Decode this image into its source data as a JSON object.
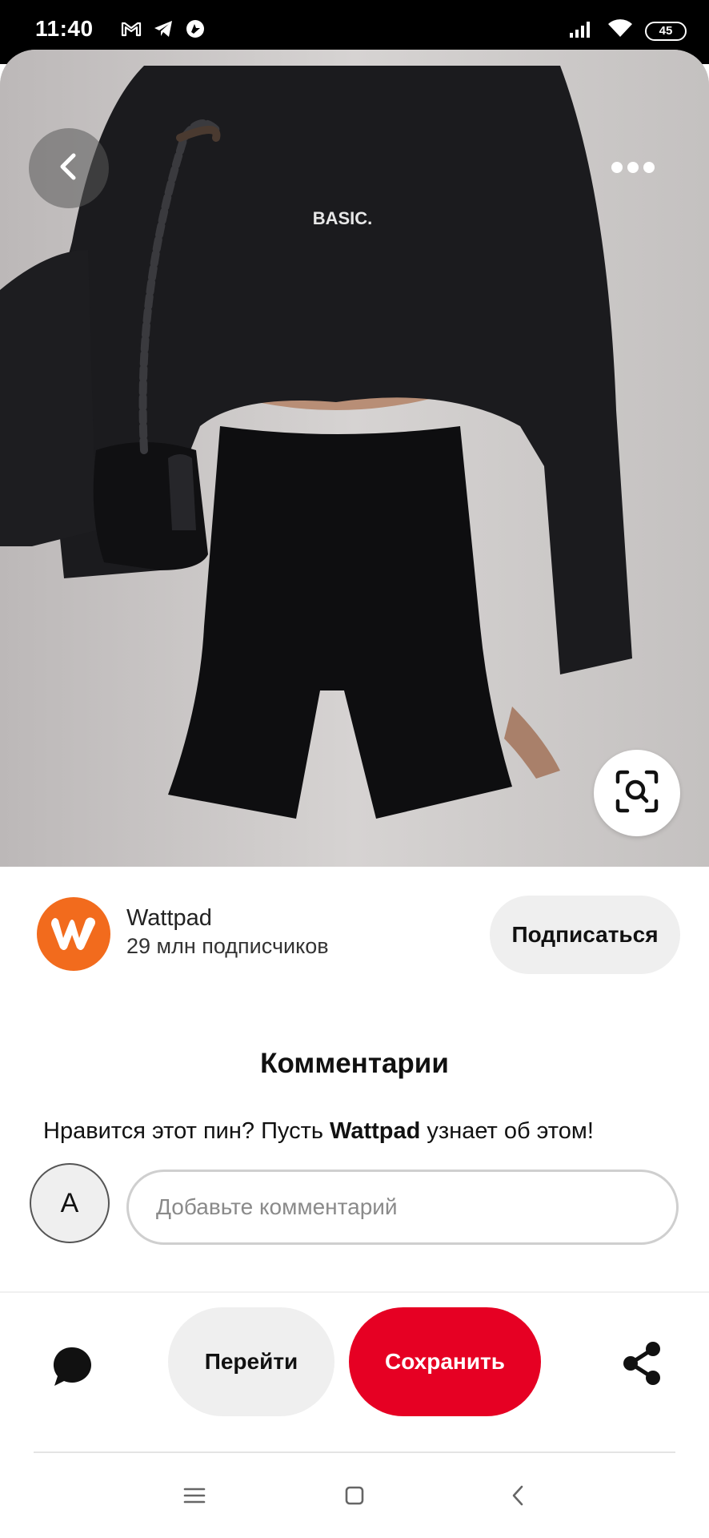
{
  "status_bar": {
    "time": "11:40",
    "left_icons": [
      "gmail-icon",
      "telegram-icon",
      "app-notification-icon"
    ],
    "right_icons": [
      "signal-icon",
      "wifi-icon"
    ],
    "battery": "45"
  },
  "pin": {
    "image_text": "BASIC.",
    "icons": {
      "back": "chevron-left-icon",
      "more": "more-dots-icon",
      "lens": "visual-search-icon"
    }
  },
  "creator": {
    "name": "Wattpad",
    "followers": "29 млн подписчиков",
    "subscribe_label": "Подписаться",
    "avatar_color": "#f26b1d"
  },
  "comments": {
    "title": "Комментарии",
    "prompt_before": "Нравится этот пин? Пусть ",
    "prompt_bold": "Wattpad",
    "prompt_after": " узнает об этом!",
    "user_initial": "A",
    "input_placeholder": "Добавьте комментарий"
  },
  "actions": {
    "visit_label": "Перейти",
    "save_label": "Сохранить",
    "save_color": "#e60023",
    "icons": {
      "comment": "speech-bubble-icon",
      "share": "share-icon"
    }
  },
  "nav_bar": {
    "icons": [
      "menu-icon",
      "home-square-icon",
      "back-chevron-icon"
    ]
  }
}
